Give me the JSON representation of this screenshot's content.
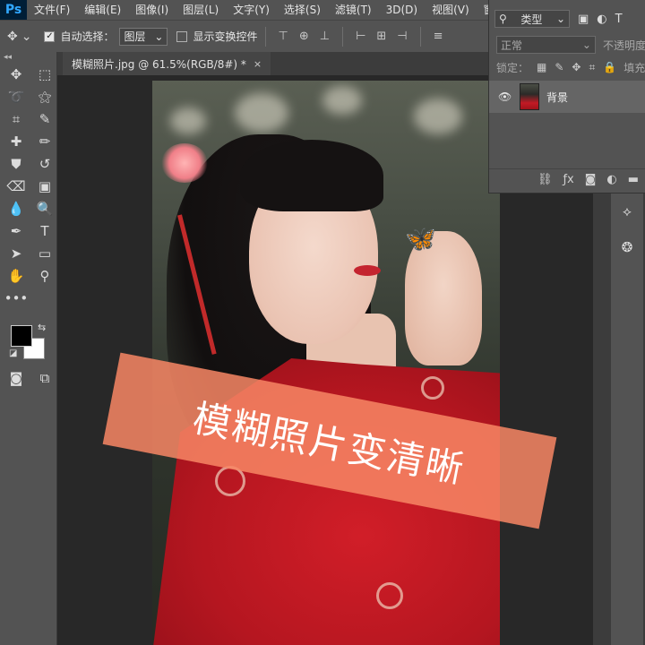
{
  "app": {
    "logo": "Ps"
  },
  "menu": [
    "文件(F)",
    "编辑(E)",
    "图像(I)",
    "图层(L)",
    "文字(Y)",
    "选择(S)",
    "滤镜(T)",
    "3D(D)",
    "视图(V)",
    "窗口"
  ],
  "options": {
    "auto_select_label": "自动选择：",
    "auto_select_value": "图层",
    "show_transform_label": "显示变换控件"
  },
  "document": {
    "tab_title": "模糊照片.jpg @ 61.5%(RGB/8#) *",
    "close": "×"
  },
  "overlay": {
    "text": "模糊照片变清晰"
  },
  "layers_panel": {
    "filter_type": "类型",
    "blend_mode": "正常",
    "opacity_label": "不透明度",
    "lock_label": "锁定：",
    "fill_label": "填充",
    "layer_name": "背景"
  },
  "colors": {
    "ui_dark": "#535353",
    "canvas_bg": "#282828",
    "banner": "#f78664",
    "accent_ps": "#31a8ff"
  }
}
